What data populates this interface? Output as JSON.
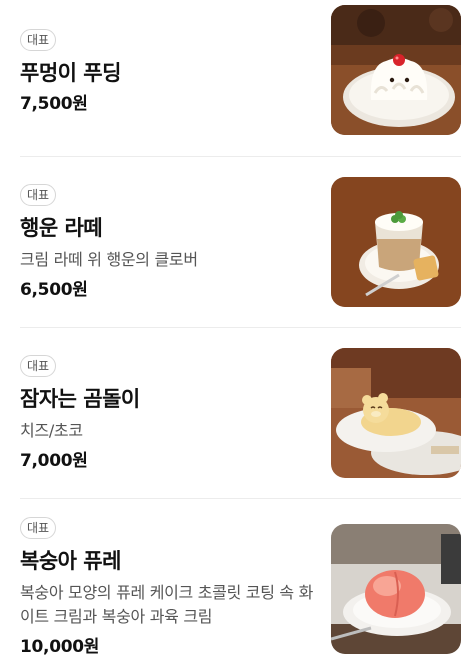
{
  "menu_items": [
    {
      "badge": "대표",
      "name": "푸멍이 푸딩",
      "description": "",
      "price": "7,500원",
      "image": "white fluffy pudding with strawberry on plate"
    },
    {
      "badge": "대표",
      "name": "행운 라떼",
      "description": "크림 라떼 위 행운의 클로버",
      "price": "6,500원",
      "image": "cream latte cup with clover and cookie"
    },
    {
      "badge": "대표",
      "name": "잠자는 곰돌이",
      "description": "치즈/초코",
      "price": "7,000원",
      "image": "sleeping bear cake on plate"
    },
    {
      "badge": "대표",
      "name": "복숭아 퓨레",
      "description": "복숭아 모양의 퓨레 케이크 초콜릿 코팅 속 화이트 크림과 복숭아 과육 크림",
      "price": "10,000원",
      "image": "peach shaped puree cake on plate"
    }
  ]
}
